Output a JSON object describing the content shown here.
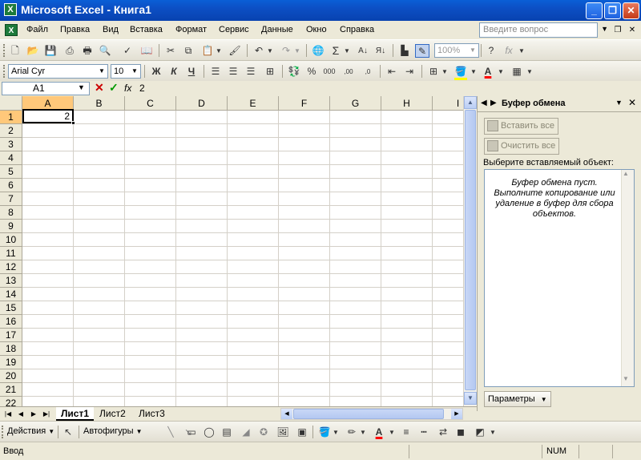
{
  "window": {
    "title": "Microsoft Excel - Книга1"
  },
  "menu": {
    "items": [
      "Файл",
      "Правка",
      "Вид",
      "Вставка",
      "Формат",
      "Сервис",
      "Данные",
      "Окно",
      "Справка"
    ],
    "help_placeholder": "Введите вопрос"
  },
  "toolbar_standard": {
    "zoom": "100%",
    "fx": "fx"
  },
  "toolbar_formatting": {
    "font": "Arial Cyr",
    "size": "10",
    "bold": "Ж",
    "italic": "К",
    "underline": "Ч",
    "font_color": "#ff0000",
    "fill_color": "#ffff00"
  },
  "formula_bar": {
    "cell_ref": "A1",
    "fx": "fx",
    "content": "2"
  },
  "grid": {
    "columns": [
      "A",
      "B",
      "C",
      "D",
      "E",
      "F",
      "G",
      "H",
      "I"
    ],
    "rows": [
      "1",
      "2",
      "3",
      "4",
      "5",
      "6",
      "7",
      "8",
      "9",
      "10",
      "11",
      "12",
      "13",
      "14",
      "15",
      "16",
      "17",
      "18",
      "19",
      "20",
      "21",
      "22"
    ],
    "active_cell_value": "2"
  },
  "sheets": {
    "tabs": [
      "Лист1",
      "Лист2",
      "Лист3"
    ],
    "active": "Лист1"
  },
  "task_pane": {
    "title": "Буфер обмена",
    "paste_all": "Вставить все",
    "clear_all": "Очистить все",
    "prompt": "Выберите вставляемый объект:",
    "empty_message": "Буфер обмена пуст. Выполните копирование или удаление в буфер для сбора объектов.",
    "options": "Параметры"
  },
  "drawing_toolbar": {
    "actions": "Действия",
    "autoshapes": "Автофигуры"
  },
  "status_bar": {
    "mode": "Ввод",
    "num": "NUM"
  },
  "colors": {
    "title_bar": "#0c4fc4",
    "selection_header": "#ffc87a",
    "excel_green": "#1d7a3a"
  }
}
